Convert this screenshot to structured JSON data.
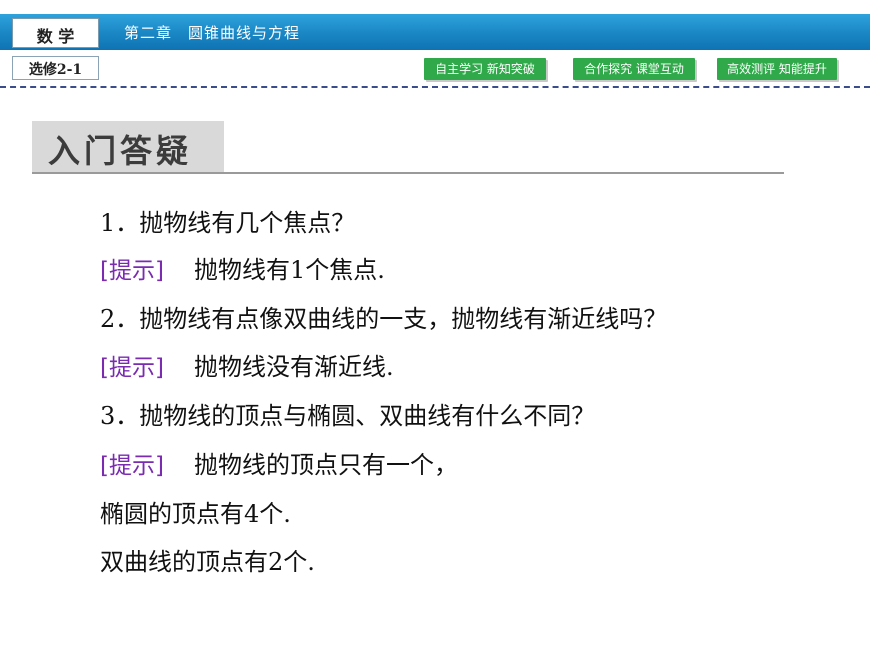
{
  "header": {
    "subject": "数 学",
    "chapter": "第二章　圆锥曲线与方程",
    "course": "选修2-1",
    "nav": [
      {
        "label": "自主学习 新知突破"
      },
      {
        "label": "合作探究 课堂互动"
      },
      {
        "label": "高效测评 知能提升"
      }
    ]
  },
  "section": {
    "title": "入门答疑"
  },
  "qa": {
    "q1": "1．抛物线有几个焦点？",
    "hint_tag": "[提示]",
    "a1": "抛物线有1个焦点.",
    "q2": "2．抛物线有点像双曲线的一支，抛物线有渐近线吗？",
    "a2": "抛物线没有渐近线.",
    "q3": "3．抛物线的顶点与椭圆、双曲线有什么不同？",
    "a3_line1": "抛物线的顶点只有一个，",
    "a3_line2": "椭圆的顶点有4个.",
    "a3_line3": "双曲线的顶点有2个."
  },
  "colors": {
    "banner": "#1a86c4",
    "nav_button": "#2fa94a",
    "hint_tag": "#7a2bb0"
  }
}
